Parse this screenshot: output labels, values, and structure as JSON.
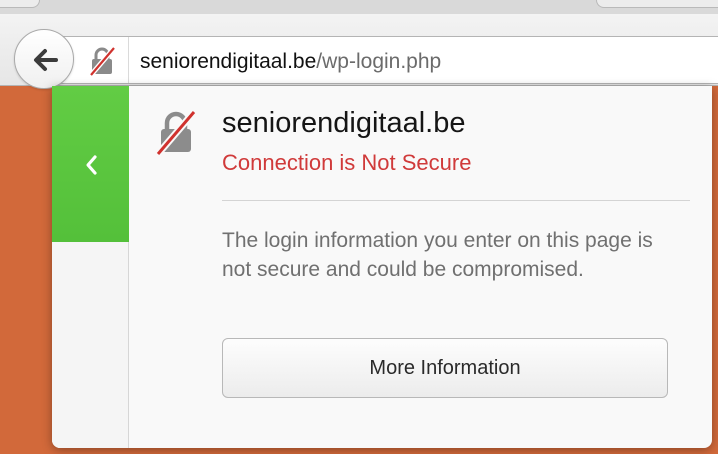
{
  "urlbar": {
    "domain": "seniorendigitaal.be",
    "path": "/wp-login.php",
    "lock_icon": "insecure-lock-icon"
  },
  "toolbar": {
    "back_icon": "back-arrow-icon"
  },
  "identity_panel": {
    "host": "seniorendigitaal.be",
    "status": "Connection is Not Secure",
    "description": "The login information you enter on this page is not secure and could be compromised.",
    "more_info_label": "More Information",
    "back_icon": "chevron-left-icon"
  },
  "colors": {
    "insecure": "#d03a3a",
    "panel_back_green": "#5ac63e",
    "page_background": "#d2693a"
  }
}
